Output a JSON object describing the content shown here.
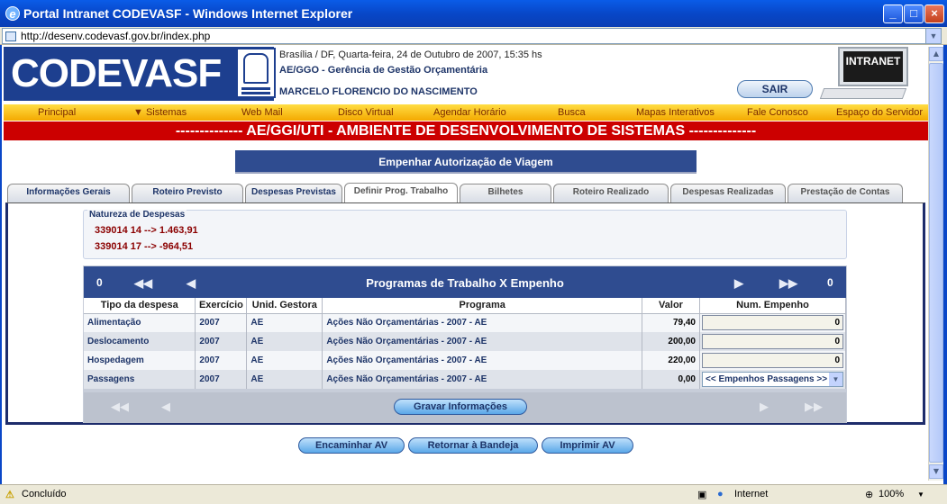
{
  "window": {
    "title": "Portal Intranet CODEVASF - Windows Internet Explorer",
    "minimize": "_",
    "maximize": "□",
    "close": "×"
  },
  "address": {
    "url": "http://desenv.codevasf.gov.br/index.php"
  },
  "header": {
    "logo": "CODEVASF",
    "datetime": "Brasília / DF, Quarta-feira, 24 de Outubro de 2007, 15:35 hs",
    "department": "AE/GGO - Gerência de Gestão Orçamentária",
    "user": "MARCELO FLORENCIO DO NASCIMENTO",
    "logout": "SAIR",
    "intranet": "INTRANET"
  },
  "menu": [
    "Principal",
    "▼ Sistemas",
    "Web Mail",
    "Disco Virtual",
    "Agendar Horário",
    "Busca",
    "Mapas Interativos",
    "Fale Conosco",
    "Espaço do Servidor"
  ],
  "banner": "--------------   AE/GGI/UTI - AMBIENTE DE DESENVOLVIMENTO DE SISTEMAS   --------------",
  "page_title": "Empenhar Autorização de Viagem",
  "tabs": [
    "Informações Gerais",
    "Roteiro Previsto",
    "Despesas Previstas",
    "Definir Prog. Trabalho",
    "Bilhetes",
    "Roteiro Realizado",
    "Despesas Realizadas",
    "Prestação de Contas"
  ],
  "natureza": {
    "title": "Natureza de Despesas",
    "lines": [
      "339014 14 --> 1.463,91",
      "339014 17 --> -964,51"
    ]
  },
  "programas": {
    "title": "Programas de Trabalho X Empenho",
    "count_left": "0",
    "count_right": "0",
    "columns": [
      "Tipo da despesa",
      "Exercício",
      "Unid. Gestora",
      "Programa",
      "Valor",
      "Num. Empenho"
    ],
    "rows": [
      {
        "tipo": "Alimentação",
        "exercicio": "2007",
        "unidade": "AE",
        "programa": "Ações Não Orçamentárias - 2007 - AE",
        "valor": "79,40",
        "empenho": "0"
      },
      {
        "tipo": "Deslocamento",
        "exercicio": "2007",
        "unidade": "AE",
        "programa": "Ações Não Orçamentárias - 2007 - AE",
        "valor": "200,00",
        "empenho": "0"
      },
      {
        "tipo": "Hospedagem",
        "exercicio": "2007",
        "unidade": "AE",
        "programa": "Ações Não Orçamentárias - 2007 - AE",
        "valor": "220,00",
        "empenho": "0"
      },
      {
        "tipo": "Passagens",
        "exercicio": "2007",
        "unidade": "AE",
        "programa": "Ações Não Orçamentárias - 2007 - AE",
        "valor": "0,00",
        "empenho": "<< Empenhos Passagens >>"
      }
    ],
    "save": "Gravar Informações"
  },
  "actions": [
    "Encaminhar AV",
    "Retornar à Bandeja",
    "Imprimir AV"
  ],
  "status": {
    "text": "Concluído",
    "zone": "Internet",
    "zoom": "100%"
  }
}
